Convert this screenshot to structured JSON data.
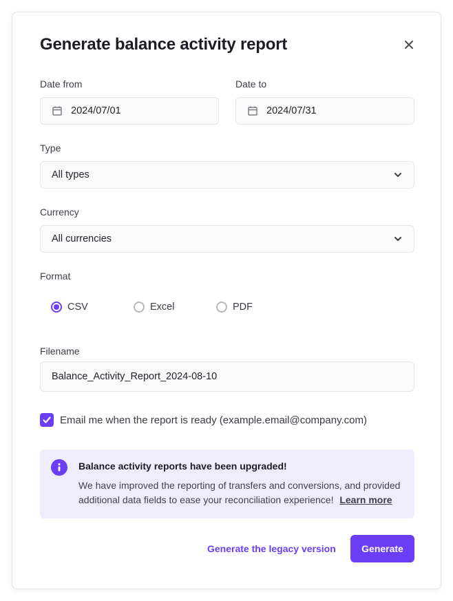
{
  "modal": {
    "title": "Generate balance activity report",
    "close_icon": "close-icon"
  },
  "date_from": {
    "label": "Date from",
    "value": "2024/07/01",
    "icon": "calendar-icon"
  },
  "date_to": {
    "label": "Date to",
    "value": "2024/07/31",
    "icon": "calendar-icon"
  },
  "type": {
    "label": "Type",
    "value": "All types",
    "icon": "chevron-down-icon"
  },
  "currency": {
    "label": "Currency",
    "value": "All currencies",
    "icon": "chevron-down-icon"
  },
  "format": {
    "label": "Format",
    "options": [
      {
        "label": "CSV",
        "selected": true
      },
      {
        "label": "Excel",
        "selected": false
      },
      {
        "label": "PDF",
        "selected": false
      }
    ]
  },
  "filename": {
    "label": "Filename",
    "value": "Balance_Activity_Report_2024-08-10"
  },
  "email_checkbox": {
    "label": "Email me when the report is ready (example.email@company.com)",
    "checked": true
  },
  "banner": {
    "icon": "info-icon",
    "title": "Balance activity reports have been upgraded!",
    "body": "We have improved the reporting of transfers and conversions, and provided additional data fields to ease your reconciliation experience!",
    "link_label": "Learn more"
  },
  "actions": {
    "legacy_label": "Generate the legacy version",
    "generate_label": "Generate"
  },
  "colors": {
    "accent": "#6b3ef5",
    "banner_bg": "#efedfd",
    "field_bg": "#fafafa"
  }
}
